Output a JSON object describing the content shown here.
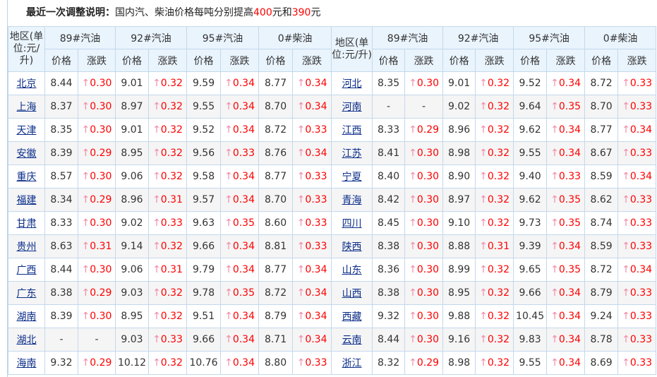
{
  "note": {
    "label": "最近一次调整说明：",
    "text_before": "国内汽、柴油价格每吨分别提高",
    "gas_increase": "400",
    "mid": "元和",
    "diesel_increase": "390",
    "after": "元"
  },
  "header": {
    "region_left": "地区(单位:元/升)",
    "region_right": "地区(单位:元/升)",
    "fuels": [
      "89#汽油",
      "92#汽油",
      "95#汽油",
      "0#柴油"
    ],
    "price": "价格",
    "change": "涨跌"
  },
  "colors": {
    "up": "#ff0000",
    "link": "#0b2e8a",
    "header_bg": "#eaf4fd",
    "border": "#c4d8eb"
  },
  "rows": [
    {
      "left": {
        "region": "北京",
        "v": [
          "8.44",
          "0.30",
          "9.01",
          "0.32",
          "9.59",
          "0.34",
          "8.77",
          "0.34"
        ]
      },
      "right": {
        "region": "河北",
        "v": [
          "8.35",
          "0.30",
          "9.01",
          "0.32",
          "9.52",
          "0.34",
          "8.72",
          "0.33"
        ]
      }
    },
    {
      "left": {
        "region": "上海",
        "v": [
          "8.37",
          "0.30",
          "8.97",
          "0.32",
          "9.55",
          "0.34",
          "8.70",
          "0.34"
        ]
      },
      "right": {
        "region": "河南",
        "v": [
          "-",
          "-",
          "9.02",
          "0.32",
          "9.64",
          "0.35",
          "8.70",
          "0.33"
        ]
      }
    },
    {
      "left": {
        "region": "天津",
        "v": [
          "8.35",
          "0.30",
          "9.01",
          "0.32",
          "9.52",
          "0.34",
          "8.72",
          "0.33"
        ]
      },
      "right": {
        "region": "江西",
        "v": [
          "8.33",
          "0.29",
          "8.96",
          "0.32",
          "9.62",
          "0.34",
          "8.77",
          "0.34"
        ]
      }
    },
    {
      "left": {
        "region": "安徽",
        "v": [
          "8.39",
          "0.29",
          "8.95",
          "0.32",
          "9.56",
          "0.33",
          "8.76",
          "0.34"
        ]
      },
      "right": {
        "region": "江苏",
        "v": [
          "8.41",
          "0.30",
          "8.98",
          "0.32",
          "9.55",
          "0.34",
          "8.67",
          "0.33"
        ]
      }
    },
    {
      "left": {
        "region": "重庆",
        "v": [
          "8.57",
          "0.30",
          "9.06",
          "0.32",
          "9.58",
          "0.34",
          "8.77",
          "0.33"
        ]
      },
      "right": {
        "region": "宁夏",
        "v": [
          "8.40",
          "0.30",
          "8.90",
          "0.32",
          "9.40",
          "0.33",
          "8.59",
          "0.34"
        ]
      }
    },
    {
      "left": {
        "region": "福建",
        "v": [
          "8.34",
          "0.29",
          "8.96",
          "0.31",
          "9.57",
          "0.34",
          "8.70",
          "0.33"
        ]
      },
      "right": {
        "region": "青海",
        "v": [
          "8.42",
          "0.30",
          "8.97",
          "0.32",
          "9.62",
          "0.35",
          "8.62",
          "0.33"
        ]
      }
    },
    {
      "left": {
        "region": "甘肃",
        "v": [
          "8.33",
          "0.30",
          "9.02",
          "0.33",
          "9.63",
          "0.35",
          "8.60",
          "0.33"
        ]
      },
      "right": {
        "region": "四川",
        "v": [
          "8.45",
          "0.30",
          "9.10",
          "0.32",
          "9.73",
          "0.35",
          "8.74",
          "0.33"
        ]
      }
    },
    {
      "left": {
        "region": "贵州",
        "v": [
          "8.63",
          "0.31",
          "9.14",
          "0.32",
          "9.66",
          "0.34",
          "8.81",
          "0.33"
        ]
      },
      "right": {
        "region": "陕西",
        "v": [
          "8.38",
          "0.30",
          "8.88",
          "0.31",
          "9.39",
          "0.34",
          "8.59",
          "0.33"
        ]
      }
    },
    {
      "left": {
        "region": "广西",
        "v": [
          "8.44",
          "0.30",
          "9.06",
          "0.31",
          "9.79",
          "0.34",
          "8.77",
          "0.34"
        ]
      },
      "right": {
        "region": "山东",
        "v": [
          "8.36",
          "0.30",
          "8.99",
          "0.32",
          "9.65",
          "0.35",
          "8.72",
          "0.34"
        ]
      }
    },
    {
      "left": {
        "region": "广东",
        "v": [
          "8.38",
          "0.29",
          "9.03",
          "0.32",
          "9.78",
          "0.35",
          "8.72",
          "0.34"
        ]
      },
      "right": {
        "region": "山西",
        "v": [
          "8.38",
          "0.30",
          "8.95",
          "0.32",
          "9.66",
          "0.34",
          "8.79",
          "0.33"
        ]
      }
    },
    {
      "left": {
        "region": "湖南",
        "v": [
          "8.39",
          "0.30",
          "8.95",
          "0.32",
          "9.51",
          "0.34",
          "8.79",
          "0.34"
        ]
      },
      "right": {
        "region": "西藏",
        "v": [
          "9.32",
          "0.30",
          "9.88",
          "0.32",
          "10.45",
          "0.34",
          "9.24",
          "0.33"
        ]
      }
    },
    {
      "left": {
        "region": "湖北",
        "v": [
          "-",
          "-",
          "9.03",
          "0.33",
          "9.66",
          "0.34",
          "8.71",
          "0.34"
        ]
      },
      "right": {
        "region": "云南",
        "v": [
          "8.44",
          "0.30",
          "9.16",
          "0.32",
          "9.83",
          "0.34",
          "8.78",
          "0.33"
        ]
      }
    },
    {
      "left": {
        "region": "海南",
        "v": [
          "9.32",
          "0.29",
          "10.12",
          "0.32",
          "10.76",
          "0.34",
          "8.80",
          "0.33"
        ]
      },
      "right": {
        "region": "浙江",
        "v": [
          "8.32",
          "0.29",
          "8.98",
          "0.32",
          "9.55",
          "0.34",
          "8.69",
          "0.33"
        ]
      }
    }
  ]
}
